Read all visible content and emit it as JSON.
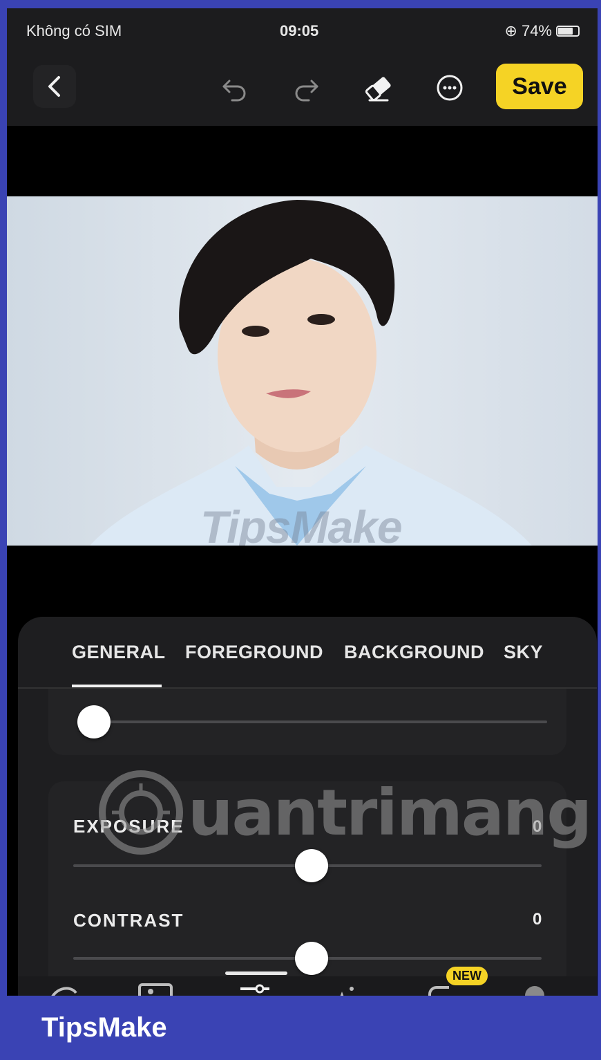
{
  "status_bar": {
    "carrier": "Không có SIM",
    "time": "09:05",
    "battery": "74%"
  },
  "toolbar": {
    "back_icon": "chevron-left-icon",
    "undo_icon": "undo-icon",
    "redo_icon": "redo-icon",
    "erase_icon": "eraser-icon",
    "more_icon": "more-options-icon",
    "save_label": "Save"
  },
  "photo": {
    "watermark": "TipsMake"
  },
  "tabs": [
    {
      "label": "GENERAL",
      "active": true
    },
    {
      "label": "FOREGROUND",
      "active": false
    },
    {
      "label": "BACKGROUND",
      "active": false
    },
    {
      "label": "SKY",
      "active": false
    }
  ],
  "sliders": [
    {
      "label": "",
      "value": "",
      "position": 0.0
    },
    {
      "label": "EXPOSURE",
      "value": "0",
      "position": 0.5
    },
    {
      "label": "CONTRAST",
      "value": "0",
      "position": 0.5
    }
  ],
  "overlay_watermark": "uantrimang",
  "bottom_toolbar": {
    "new_badge": "NEW"
  },
  "footer": {
    "brand": "TipsMake"
  },
  "colors": {
    "accent": "#f5d325",
    "frame": "#3a43b4",
    "panel": "#1e1e20"
  }
}
